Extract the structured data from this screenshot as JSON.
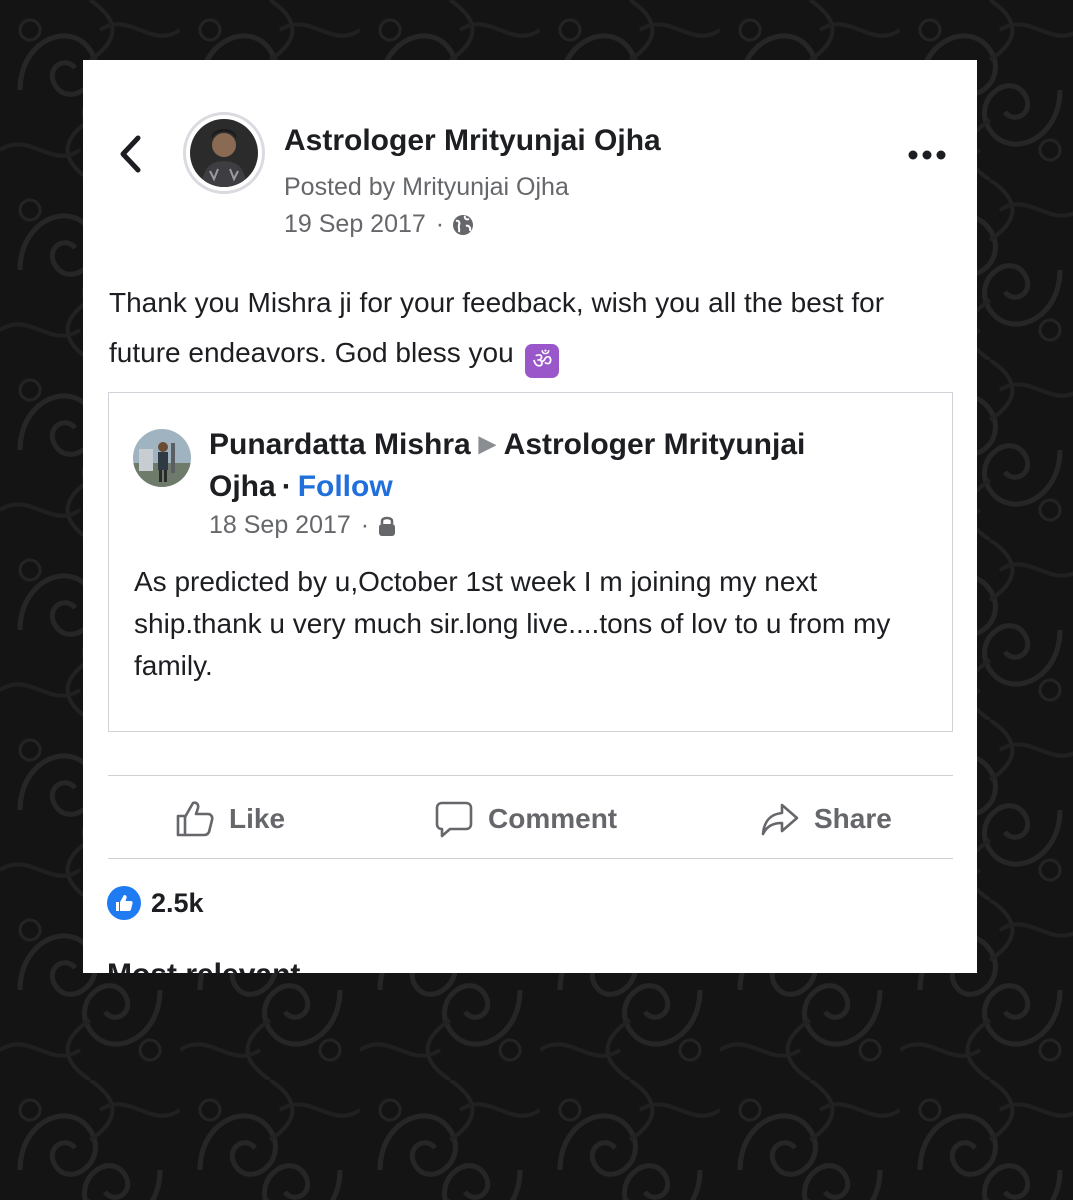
{
  "post": {
    "page_name": "Astrologer Mrityunjai Ojha",
    "posted_by": "Posted by Mrityunjai Ojha",
    "date": "19 Sep 2017",
    "separator": "·",
    "privacy_icon": "globe-icon",
    "text": "Thank you Mishra ji for your feedback, wish you all the best for future endeavors. God bless you",
    "emoji": "ॐ"
  },
  "shared_post": {
    "author": "Punardatta Mishra",
    "arrow": "▶",
    "target_page": "Astrologer Mrityunjai Ojha",
    "separator": "·",
    "follow_label": "Follow",
    "date": "18 Sep 2017",
    "privacy_icon": "lock-icon",
    "text": "As predicted by u,October 1st week I m joining my next ship.thank u very much sir.long live....tons of lov to u from my family."
  },
  "actions": {
    "like": "Like",
    "comment": "Comment",
    "share": "Share"
  },
  "reactions": {
    "count": "2.5k",
    "icon": "thumbs-up-icon"
  },
  "next_section": {
    "heading": "Most relevant"
  },
  "colors": {
    "link_blue": "#216fdb",
    "secondary_text": "#65676b",
    "like_blue": "#1f7bf2",
    "om_purple": "#9a57c9"
  }
}
